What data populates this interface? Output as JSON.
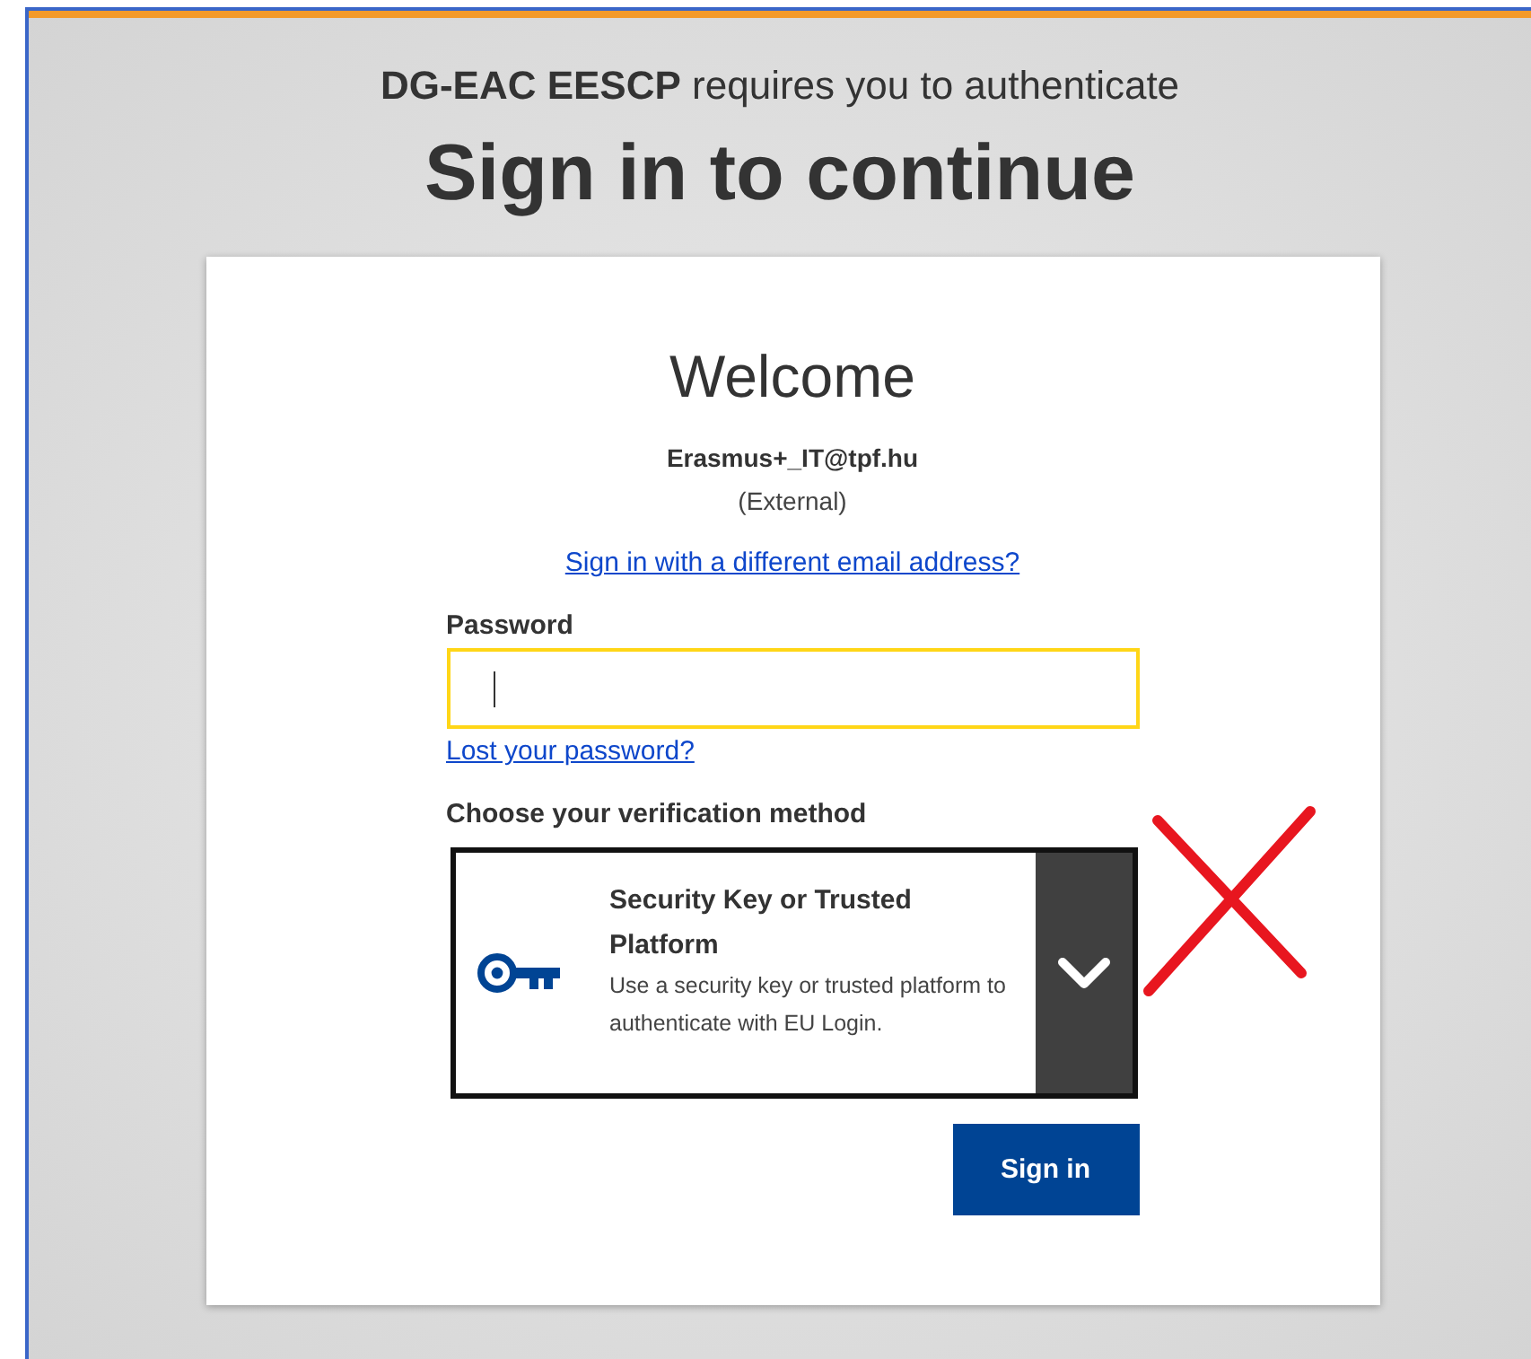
{
  "header": {
    "prompt": "**DG-EAC EESCP** requires you to authenticate",
    "title": "Sign in to continue"
  },
  "card": {
    "heading": "Welcome",
    "email": "Erasmus+_IT@tpf.hu",
    "account_type": "(External)",
    "switch_link": "Sign in with a different email address?",
    "password": {
      "label": "Password",
      "focused": true
    },
    "lost_password_link": "Lost your password?",
    "method": {
      "label": "Choose your verification method",
      "title": "Security Key or Trusted Platform",
      "description": "Use a security key or trusted platform to authenticate with EU Login.",
      "expanded": false
    },
    "sign_in_button": "Sign in"
  }
}
